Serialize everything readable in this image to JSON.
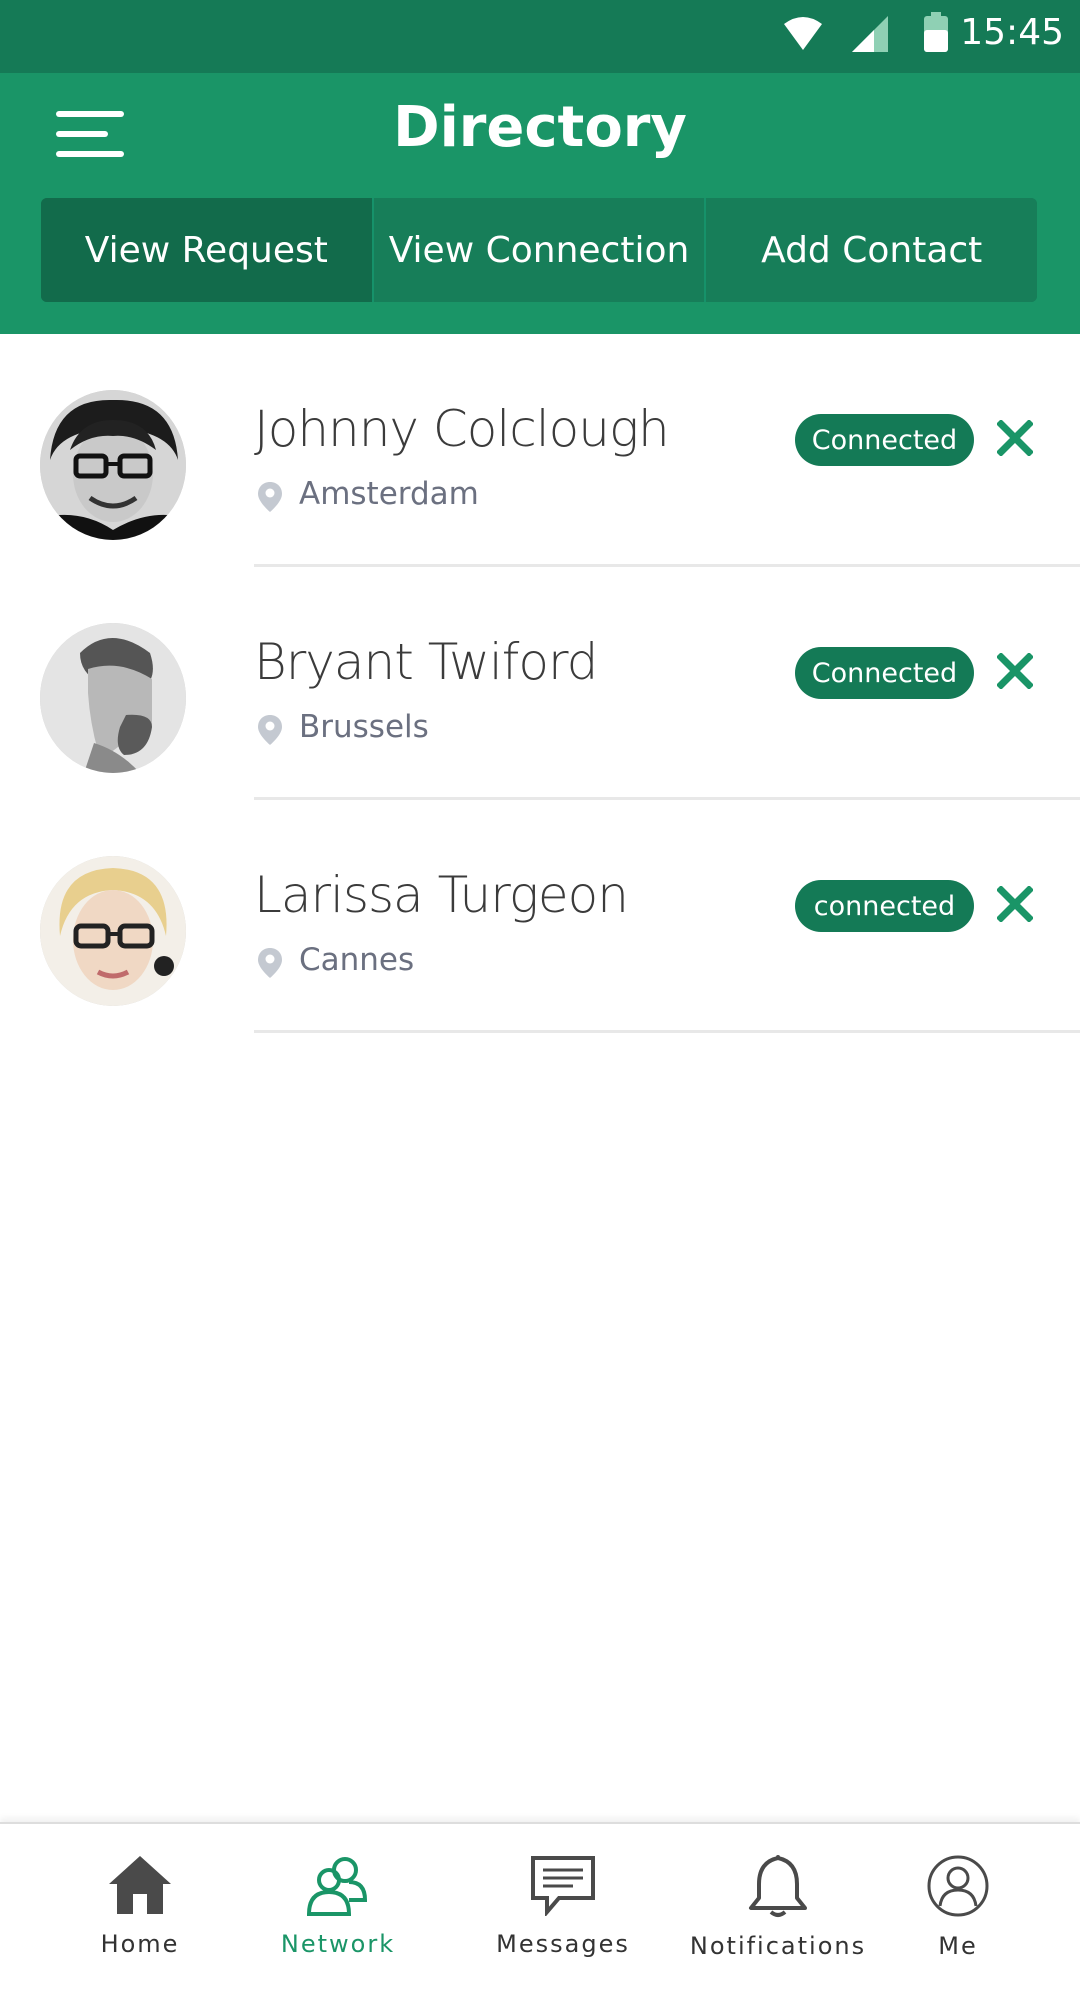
{
  "status_bar": {
    "time": "15:45"
  },
  "header": {
    "title": "Directory",
    "tabs": [
      {
        "label": "View Request",
        "active": true
      },
      {
        "label": "View Connection",
        "active": false
      },
      {
        "label": "Add Contact",
        "active": false
      }
    ]
  },
  "contacts": [
    {
      "name": "Johnny Colclough",
      "city": "Amsterdam",
      "status": "Connected"
    },
    {
      "name": "Bryant Twiford",
      "city": "Brussels",
      "status": "Connected"
    },
    {
      "name": "Larissa Turgeon",
      "city": "Cannes",
      "status": "connected"
    }
  ],
  "bottom_nav": {
    "items": [
      {
        "label": "Home",
        "icon": "home-icon",
        "active": false
      },
      {
        "label": "Network",
        "icon": "network-icon",
        "active": true
      },
      {
        "label": "Messages",
        "icon": "messages-icon",
        "active": false
      },
      {
        "label": "Notifications",
        "icon": "bell-icon",
        "active": false
      },
      {
        "label": "Me",
        "icon": "profile-icon",
        "active": false
      }
    ]
  },
  "colors": {
    "primary": "#1a9567",
    "primary_dark": "#157a56",
    "badge": "#147a56",
    "text_dark": "#3b3b3b",
    "text_muted": "#6b7080"
  }
}
